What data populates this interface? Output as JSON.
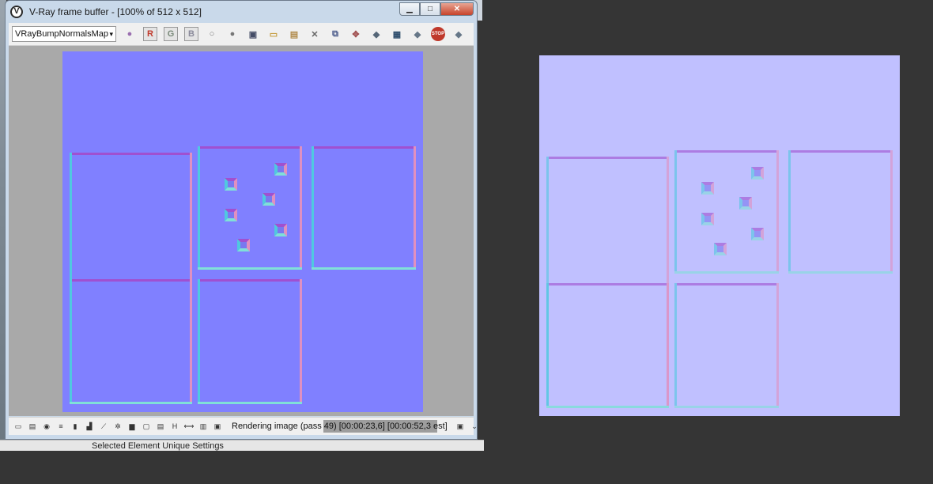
{
  "window": {
    "title": "V-Ray frame buffer - [100% of 512 x 512]",
    "minimize_label": "▁",
    "maximize_label": "□",
    "close_label": "✕",
    "icon_glyph": "V"
  },
  "toolbar": {
    "channel_value": "VRayBumpNormalsMap",
    "channel_arrow": "▾",
    "icons": [
      {
        "name": "channels-icon",
        "glyph": "●",
        "color": "#9a6fb0"
      },
      {
        "name": "red-channel-icon",
        "glyph": "R",
        "color": "#c0392b"
      },
      {
        "name": "green-channel-icon",
        "glyph": "G",
        "color": "#7a8a7a"
      },
      {
        "name": "blue-channel-icon",
        "glyph": "B",
        "color": "#8a8a9a"
      },
      {
        "name": "white-sphere-icon",
        "glyph": "○",
        "color": "#777777"
      },
      {
        "name": "gray-sphere-icon",
        "glyph": "●",
        "color": "#777777"
      },
      {
        "name": "save-icon",
        "glyph": "▣",
        "color": "#444c66"
      },
      {
        "name": "load-icon",
        "glyph": "▭",
        "color": "#c49a3a"
      },
      {
        "name": "clipboard-icon",
        "glyph": "▤",
        "color": "#b08a4a"
      },
      {
        "name": "clear-icon",
        "glyph": "✕",
        "color": "#666666"
      },
      {
        "name": "duplicate-icon",
        "glyph": "⧉",
        "color": "#4a5a8a"
      },
      {
        "name": "track-mouse-icon",
        "glyph": "✥",
        "color": "#a05050"
      },
      {
        "name": "render-region-icon",
        "glyph": "◆",
        "color": "#556677"
      },
      {
        "name": "region-icon",
        "glyph": "▦",
        "color": "#2a4a6a"
      },
      {
        "name": "render-last-icon",
        "glyph": "◆",
        "color": "#667788"
      },
      {
        "name": "stop-icon",
        "glyph": "STOP",
        "color": "#c0392b"
      },
      {
        "name": "render-icon",
        "glyph": "◆",
        "color": "#667788"
      }
    ]
  },
  "status": {
    "text_prefix": "Rendering image (pass 4",
    "text_suffix": "9) [00:00:23,6] [00:00:52,3 est]",
    "progress_percent": 100,
    "icons": [
      {
        "name": "show-corrections-icon",
        "glyph": "▭"
      },
      {
        "name": "history-icon",
        "glyph": "▤"
      },
      {
        "name": "info-icon",
        "glyph": "◉"
      },
      {
        "name": "levels-icon",
        "glyph": "≡"
      },
      {
        "name": "color-icon",
        "glyph": "▮"
      },
      {
        "name": "histogram-icon",
        "glyph": "▟"
      },
      {
        "name": "curve-icon",
        "glyph": "⟋"
      },
      {
        "name": "exposure-icon",
        "glyph": "✲"
      },
      {
        "name": "folder-icon",
        "glyph": "▆"
      },
      {
        "name": "lut-icon",
        "glyph": "▢"
      },
      {
        "name": "ocio-icon",
        "glyph": "▤"
      },
      {
        "name": "h-icon",
        "glyph": "H"
      },
      {
        "name": "flip-icon",
        "glyph": "⟷"
      },
      {
        "name": "bars-icon",
        "glyph": "▥"
      },
      {
        "name": "stamp-icon",
        "glyph": "▣"
      }
    ],
    "stop_glyph": "▣",
    "expand_glyph": "⌄"
  },
  "background": {
    "top_text": "",
    "bottom_text": "Selected Element Unique Settings"
  },
  "colors": {
    "normal_map_bg": "#8080ff",
    "preview_bg": "#c0c0ff",
    "edge_top": "#a050d0",
    "edge_left": "#50c8e0",
    "edge_right": "#e090c0",
    "edge_bottom": "#80e0d8"
  }
}
